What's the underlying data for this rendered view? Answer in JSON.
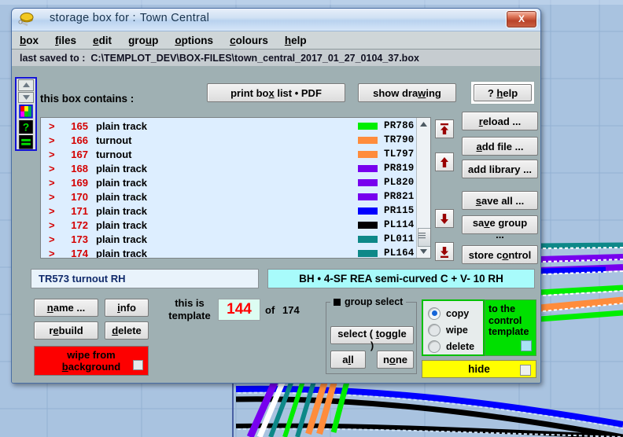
{
  "window": {
    "title_prefix": "storage  box  for :",
    "title_name": "Town Central",
    "icon": "tools-icon",
    "close_label": "X"
  },
  "menubar": {
    "items": [
      {
        "pre": "",
        "accel": "b",
        "post": "ox"
      },
      {
        "pre": "",
        "accel": "f",
        "post": "iles"
      },
      {
        "pre": "",
        "accel": "e",
        "post": "dit"
      },
      {
        "pre": "gro",
        "accel": "u",
        "post": "p"
      },
      {
        "pre": "",
        "accel": "o",
        "post": "ptions"
      },
      {
        "pre": "",
        "accel": "c",
        "post": "olours"
      },
      {
        "pre": "",
        "accel": "h",
        "post": "elp"
      }
    ]
  },
  "pathbar": {
    "label": "last saved to :",
    "path": "C:\\TEMPLOT_DEV\\BOX-FILES\\town_central_2017_01_27_0104_37.box"
  },
  "sidebar": {
    "items": [
      {
        "name": "spin-up-icon"
      },
      {
        "name": "spin-down-icon"
      },
      {
        "name": "colour-palette-icon"
      },
      {
        "name": "help-question-icon"
      },
      {
        "name": "equals-icon"
      }
    ]
  },
  "toolbar": {
    "contains_label": "this  box  contains :",
    "print_pre": "print  bo",
    "print_accel": "x",
    "print_post": "  list  •  PDF",
    "show_drawing_pre": "show  dra",
    "show_drawing_accel": "w",
    "show_drawing_post": "ing",
    "help_pre": "? ",
    "help_accel": "h",
    "help_post": "elp"
  },
  "list": {
    "rows": [
      {
        "gt": ">",
        "num": "165",
        "name": "plain track"
      },
      {
        "gt": ">",
        "num": "166",
        "name": "turnout"
      },
      {
        "gt": ">",
        "num": "167",
        "name": "turnout"
      },
      {
        "gt": ">",
        "num": "168",
        "name": "plain track"
      },
      {
        "gt": ">",
        "num": "169",
        "name": "plain track"
      },
      {
        "gt": ">",
        "num": "170",
        "name": "plain track"
      },
      {
        "gt": ">",
        "num": "171",
        "name": "plain track"
      },
      {
        "gt": ">",
        "num": "172",
        "name": "plain track"
      },
      {
        "gt": ">",
        "num": "173",
        "name": "plain track"
      },
      {
        "gt": ">",
        "num": "174",
        "name": "plain track"
      }
    ],
    "colour_rows": [
      {
        "code": "PR786",
        "colour": "#00EE00"
      },
      {
        "code": "TR790",
        "colour": "#FF8C3C"
      },
      {
        "code": "TL797",
        "colour": "#FF8C3C"
      },
      {
        "code": "PR819",
        "colour": "#7700EE"
      },
      {
        "code": "PL820",
        "colour": "#7700EE"
      },
      {
        "code": "PR821",
        "colour": "#7700EE"
      },
      {
        "code": "PR115",
        "colour": "#0000FF"
      },
      {
        "code": "PL114",
        "colour": "#000000"
      },
      {
        "code": "PL011",
        "colour": "#0E8888"
      },
      {
        "code": "PL164",
        "colour": "#0E8888"
      }
    ]
  },
  "move_buttons": [
    {
      "name": "move-to-top-button",
      "glyph": "top"
    },
    {
      "name": "move-up-button",
      "glyph": "up"
    },
    {
      "name": "move-down-button",
      "glyph": "down"
    },
    {
      "name": "move-to-bottom-button",
      "glyph": "bottom"
    }
  ],
  "right_buttons": {
    "reload_pre": "",
    "reload_accel": "r",
    "reload_post": "eload ...",
    "addfile_pre": "",
    "addfile_accel": "a",
    "addfile_post": "dd  file ...",
    "addlib": "add library ...",
    "saveall_pre": "",
    "saveall_accel": "s",
    "saveall_post": "ave  all ...",
    "savegroup_pre": "sa",
    "savegroup_accel": "v",
    "savegroup_post": "e group ...",
    "storectl_pre": "store c",
    "storectl_accel": "o",
    "storectl_post": "ntrol"
  },
  "status": {
    "left": "TR573  turnout  RH",
    "right": "BH • 4-SF  REA semi-curved  C  +  V- 10   RH"
  },
  "controls": {
    "name_pre": "",
    "name_accel": "n",
    "name_post": "ame ...",
    "info_pre": "",
    "info_accel": "i",
    "info_post": "nfo",
    "rebuild_pre": "r",
    "rebuild_accel": "e",
    "rebuild_post": "build",
    "delete_pre": "",
    "delete_accel": "d",
    "delete_post": "elete",
    "wipe_line1": "wipe  from",
    "wipe_line2_pre": "",
    "wipe_line2_accel": "b",
    "wipe_line2_post": "ackground",
    "template_label_line1": "this  is",
    "template_label_line2": "template",
    "template_number": "144",
    "of_label": "of",
    "template_total": "174",
    "nav_first": "first-template-button",
    "nav_prev": "previous-template-button",
    "nav_next": "next-template-button",
    "nav_last": "last-template-button"
  },
  "group_select": {
    "legend": "group select",
    "toggle_pre": "select  ( ",
    "toggle_accel": "t",
    "toggle_post": "oggle )",
    "all_pre": "a",
    "all_accel": "l",
    "all_post": "l",
    "none_pre": "n",
    "none_accel": "o",
    "none_post": "ne"
  },
  "action_panel": {
    "options": [
      {
        "label": "copy",
        "selected": true
      },
      {
        "label": "wipe",
        "selected": false
      },
      {
        "label": "delete",
        "selected": false
      }
    ],
    "target_line1": "to the",
    "target_line2": "control",
    "target_line3": "template",
    "hide_label": "hide"
  },
  "colours": {
    "accent_green": "#00E000",
    "warn_red": "#FD0000",
    "highlight_yellow": "#FFFF00",
    "status_cyan": "#A8FBFB",
    "list_bg": "#DDEEFF",
    "number_red": "#FF0000"
  }
}
